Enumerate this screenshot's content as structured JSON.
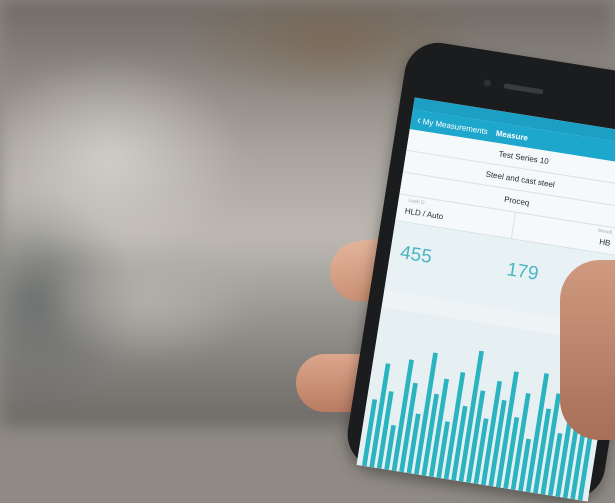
{
  "status_bar": {
    "carrier": "",
    "time": ""
  },
  "nav": {
    "back_label": "My Measurements",
    "title": "Measure"
  },
  "form": {
    "series_caption": "",
    "series_name": "Test Series 10",
    "material": "Steel and cast steel",
    "device": "Proceq",
    "left_caption": "Leeb D",
    "left_value": "HLD / Auto",
    "right_caption": "Brinell",
    "right_value": "HB"
  },
  "readings": {
    "leeb": "455",
    "brinell": "179"
  },
  "colors": {
    "accent": "#1ea7cc",
    "bars": "#2bb3c0",
    "reading": "#4bb6c2"
  },
  "chart_data": {
    "type": "bar",
    "title": "",
    "xlabel": "",
    "ylabel": "",
    "ylim": [
      0,
      100
    ],
    "values": [
      45,
      70,
      52,
      30,
      75,
      60,
      40,
      82,
      55,
      66,
      38,
      72,
      50,
      88,
      62,
      44,
      70,
      58,
      78,
      48,
      65,
      35,
      80,
      57,
      68,
      42,
      74,
      53,
      60,
      46
    ]
  }
}
